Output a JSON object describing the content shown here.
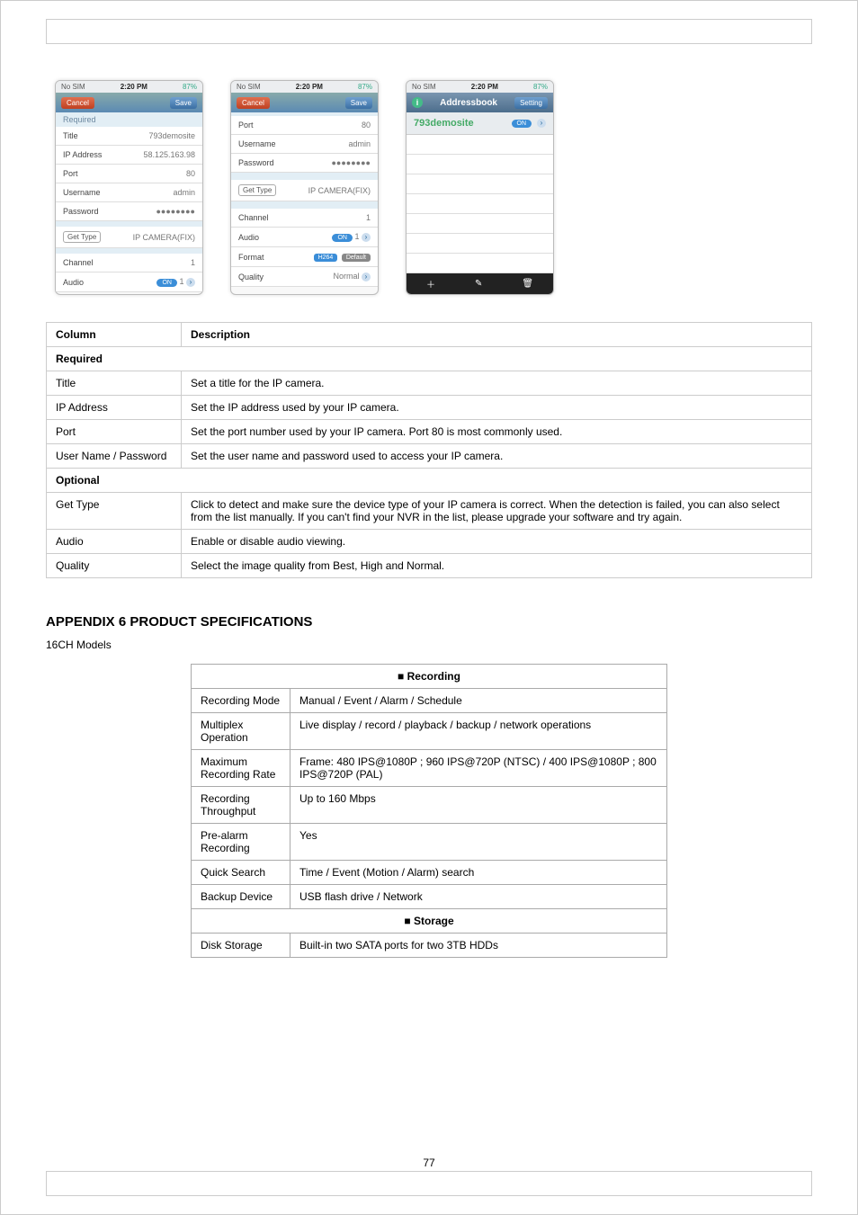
{
  "screenshots": {
    "status_left": "No SIM",
    "status_time": "2:20 PM",
    "status_batt": "87%",
    "left": {
      "nav_cancel": "Cancel",
      "nav_save": "Save",
      "section": "Required",
      "rows": [
        {
          "label": "Title",
          "value": "793demosite"
        },
        {
          "label": "IP Address",
          "value": "58.125.163.98"
        },
        {
          "label": "Port",
          "value": "80"
        },
        {
          "label": "Username",
          "value": "admin"
        },
        {
          "label": "Password",
          "value": "●●●●●●●●"
        }
      ],
      "gettype_label": "Get Type",
      "gettype_value": "IP CAMERA(FIX)",
      "channel_label": "Channel",
      "channel_value": "1",
      "audio_label": "Audio",
      "audio_toggle": "ON",
      "audio_value": "1"
    },
    "middle": {
      "nav_cancel": "Cancel",
      "nav_save": "Save",
      "rows_top": [
        {
          "label": "Port",
          "value": "80"
        },
        {
          "label": "Username",
          "value": "admin"
        },
        {
          "label": "Password",
          "value": "●●●●●●●●"
        }
      ],
      "gettype_label": "Get Type",
      "gettype_value": "IP CAMERA(FIX)",
      "channel_label": "Channel",
      "channel_value": "1",
      "audio_label": "Audio",
      "audio_toggle": "ON",
      "audio_value": "1",
      "format_label": "Format",
      "format_h264": "H264",
      "format_default": "Default",
      "quality_label": "Quality",
      "quality_value": "Normal"
    },
    "right": {
      "nav_title": "Addressbook",
      "nav_right": "Setting",
      "entry_name": "793demosite",
      "entry_toggle": "ON"
    }
  },
  "table1": {
    "header": [
      "Column",
      "Description"
    ],
    "sub1": "Required",
    "rows1": [
      {
        "c": "Title",
        "d": "Set a title for the IP camera."
      },
      {
        "c": "IP Address",
        "d": "Set the IP address used by your IP camera."
      },
      {
        "c": "Port",
        "d": "Set the port number used by your IP camera. Port 80 is most commonly used."
      },
      {
        "c": "User Name / Password",
        "d": "Set the user name and password used to access your IP camera."
      }
    ],
    "sub2": "Optional",
    "rows2": [
      {
        "c": "Get Type",
        "d": "Click to detect and make sure the device type of your IP camera is correct. When the detection is failed, you can also select from the list manually. If you can't find your NVR in the list, please upgrade your software and try again."
      },
      {
        "c": "Audio",
        "d": "Enable or disable audio viewing."
      },
      {
        "c": "Quality",
        "d": "Select the image quality from Best, High and Normal."
      }
    ]
  },
  "appendix": {
    "title": "APPENDIX 6 PRODUCT SPECIFICATIONS",
    "text": "16CH Models"
  },
  "table2": {
    "header": "■ Recording",
    "rows_a": [
      {
        "c": "Recording Mode",
        "d": "Manual / Event / Alarm / Schedule"
      },
      {
        "c": "Multiplex Operation",
        "d": "Live display / record / playback / backup / network operations"
      },
      {
        "c": "Maximum Recording Rate",
        "d": "Frame: 480 IPS@1080P ; 960 IPS@720P (NTSC) / 400 IPS@1080P ; 800 IPS@720P (PAL)"
      },
      {
        "c": "Recording Throughput",
        "d": "Up to 160 Mbps"
      },
      {
        "c": "Pre-alarm Recording",
        "d": "Yes"
      },
      {
        "c": "Quick Search",
        "d": "Time / Event (Motion / Alarm) search"
      },
      {
        "c": "Backup Device",
        "d": "USB flash drive / Network"
      }
    ],
    "header2": "■ Storage",
    "rows_b": [
      {
        "c": "Disk Storage",
        "d": "Built-in two SATA ports for two 3TB HDDs"
      }
    ]
  },
  "page_number": "77"
}
